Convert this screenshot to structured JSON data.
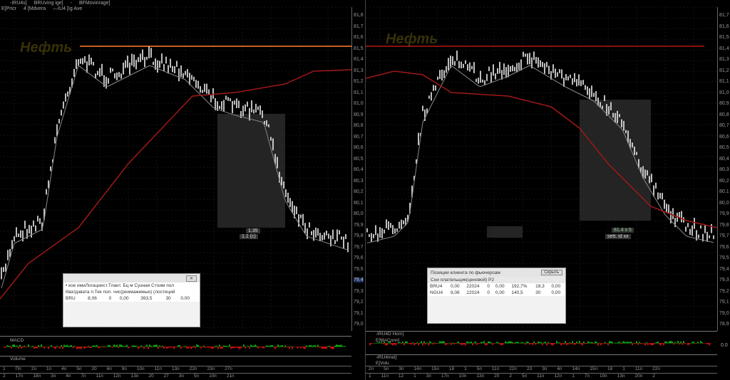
{
  "left_chart": {
    "legend_line1": [
      "-IRU4s]",
      "BRUving ige]",
      "-",
      "BFMovinrage]"
    ],
    "legend_line2": [
      "E[Pricr",
      "4 [Mdvera",
      "—IU4 [Ig Ave"
    ],
    "logo": "Нефть",
    "axis_ticks": [
      "81,8",
      "81,7",
      "81,6",
      "81,5",
      "81,4",
      "81,3",
      "81,2",
      "81,1",
      "81,0",
      "80,9",
      "80,8",
      "80,7",
      "80,6",
      "80,5",
      "80,4",
      "80,3",
      "80,2",
      "80,1",
      "80,0",
      "79,9",
      "79,8",
      "79,7",
      "79,6",
      "79,5",
      "79,4",
      "79,3",
      "79,2",
      "79,1",
      "79,0"
    ],
    "highlight_tick": "79,4",
    "price_labels": [
      "1.35",
      "1.1 (c)"
    ],
    "dialog": {
      "header1": "• кое имиЛогациист.Тлант.   Бц м   Суэная Стоим пол",
      "header2": "Кватдзвата п.Тек   пол. чис(реимажимые) (лостиций",
      "row": [
        "BRU",
        "8,06",
        "0",
        "0,00",
        "393,5",
        "30",
        "0,00"
      ]
    },
    "indicator_labels": [
      "MACD",
      "Volume"
    ],
    "time_row1": [
      "1",
      "Пп",
      "2п",
      "1п",
      "4п",
      "5п",
      "20",
      "6п",
      "9п",
      "10п",
      "11п",
      "13п",
      "22п",
      "23п",
      "27п"
    ],
    "time_row2": [
      "2",
      "17п",
      "18п",
      "3п",
      "4п",
      "7п",
      "11п",
      "12п",
      "13п",
      "20",
      "27",
      "3п",
      "5п",
      "10п",
      "21п"
    ]
  },
  "right_chart": {
    "logo": "Нефть",
    "axis_ticks": [
      "81,7",
      "81,6",
      "81,5",
      "81,4",
      "81,3",
      "81,2",
      "81,1",
      "81,0",
      "80,9",
      "80,8",
      "80,7",
      "80,6",
      "80,5",
      "80,4",
      "80,3",
      "80,2",
      "80,1",
      "80,0",
      "79,9",
      "79,8",
      "79,7",
      "79,6",
      "79,5",
      "79,4",
      "79,3",
      "79,2",
      "79,1",
      "79,0",
      "78,9"
    ],
    "price_labels": [
      "81.4 x 5",
      "sett. id xx"
    ],
    "dialog": {
      "title": "Позиции клиента по фьючерсам",
      "subtitle": "Сни плательщик(ценовой) Р2",
      "close_label": "Скрыть",
      "row1": [
        "BRU4",
        "0,00",
        "22024",
        "0",
        "0,00",
        "192,7%",
        "18,3",
        "0,00"
      ],
      "row2": [
        "NGU4",
        "8,08",
        "22024",
        "0",
        "0,00",
        "140,5",
        "30",
        "0,00"
      ]
    },
    "subpanels": [
      "-IRU4D Hom]",
      "E[MACnnn]",
      "-IRU4mel]",
      "E[Volu"
    ],
    "macd_value": "0.0",
    "time_row1": [
      "2п",
      "5п",
      "3п",
      "14п",
      "15п",
      "18",
      "1",
      "5п",
      "11п",
      "22п",
      "23",
      "3п",
      "4п",
      "14п",
      "15п",
      "18",
      "1",
      "11п",
      "22п"
    ],
    "time_row2": [
      "1",
      "11п",
      "12",
      "1",
      "3п",
      "17п",
      "10п",
      "13п",
      "20",
      "2",
      "5п",
      "11п",
      "12п",
      "1",
      "7п",
      "10п",
      "13п",
      "20п",
      "2"
    ]
  },
  "colors": {
    "background": "#000000",
    "ma_line": "#a01818",
    "level_orange": "#c86020",
    "level_red": "#8a1010",
    "axis_highlight": "#1a2a55"
  }
}
